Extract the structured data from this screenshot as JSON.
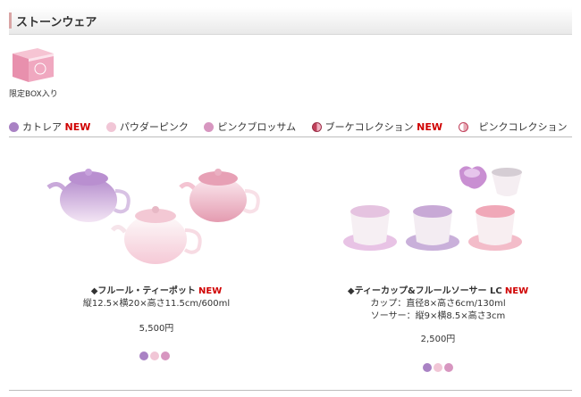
{
  "section": {
    "title": "ストーンウェア"
  },
  "box": {
    "label": "限定BOX入り"
  },
  "colors": [
    {
      "label": "カトレア",
      "badge": "NEW",
      "color": "#a982c4"
    },
    {
      "label": "パウダーピンク",
      "badge": "",
      "color": "#f1c6d6"
    },
    {
      "label": "ピンクブロッサム",
      "badge": "",
      "color": "#d796c0"
    },
    {
      "label": "ブーケコレクション",
      "badge": "NEW",
      "color": "#c0405a"
    },
    {
      "label": "ピンクコレクション",
      "badge": "",
      "color": "#e8aab6"
    }
  ],
  "products": [
    {
      "name": "◆フルール・ティーポット",
      "badge": "NEW",
      "specs": [
        "縦12.5×横20×高さ11.5cm/600ml"
      ],
      "price": "5,500円",
      "swatches": [
        "#a982c4",
        "#f1c6d6",
        "#d796c0"
      ]
    },
    {
      "name": "◆ティーカップ&フルールソーサー LC",
      "badge": "NEW",
      "specs": [
        "カップ：直径8×高さ6cm/130ml",
        "ソーサー：縦9×横8.5×高さ3cm"
      ],
      "price": "2,500円",
      "swatches": [
        "#a982c4",
        "#f1c6d6",
        "#d796c0"
      ]
    }
  ]
}
